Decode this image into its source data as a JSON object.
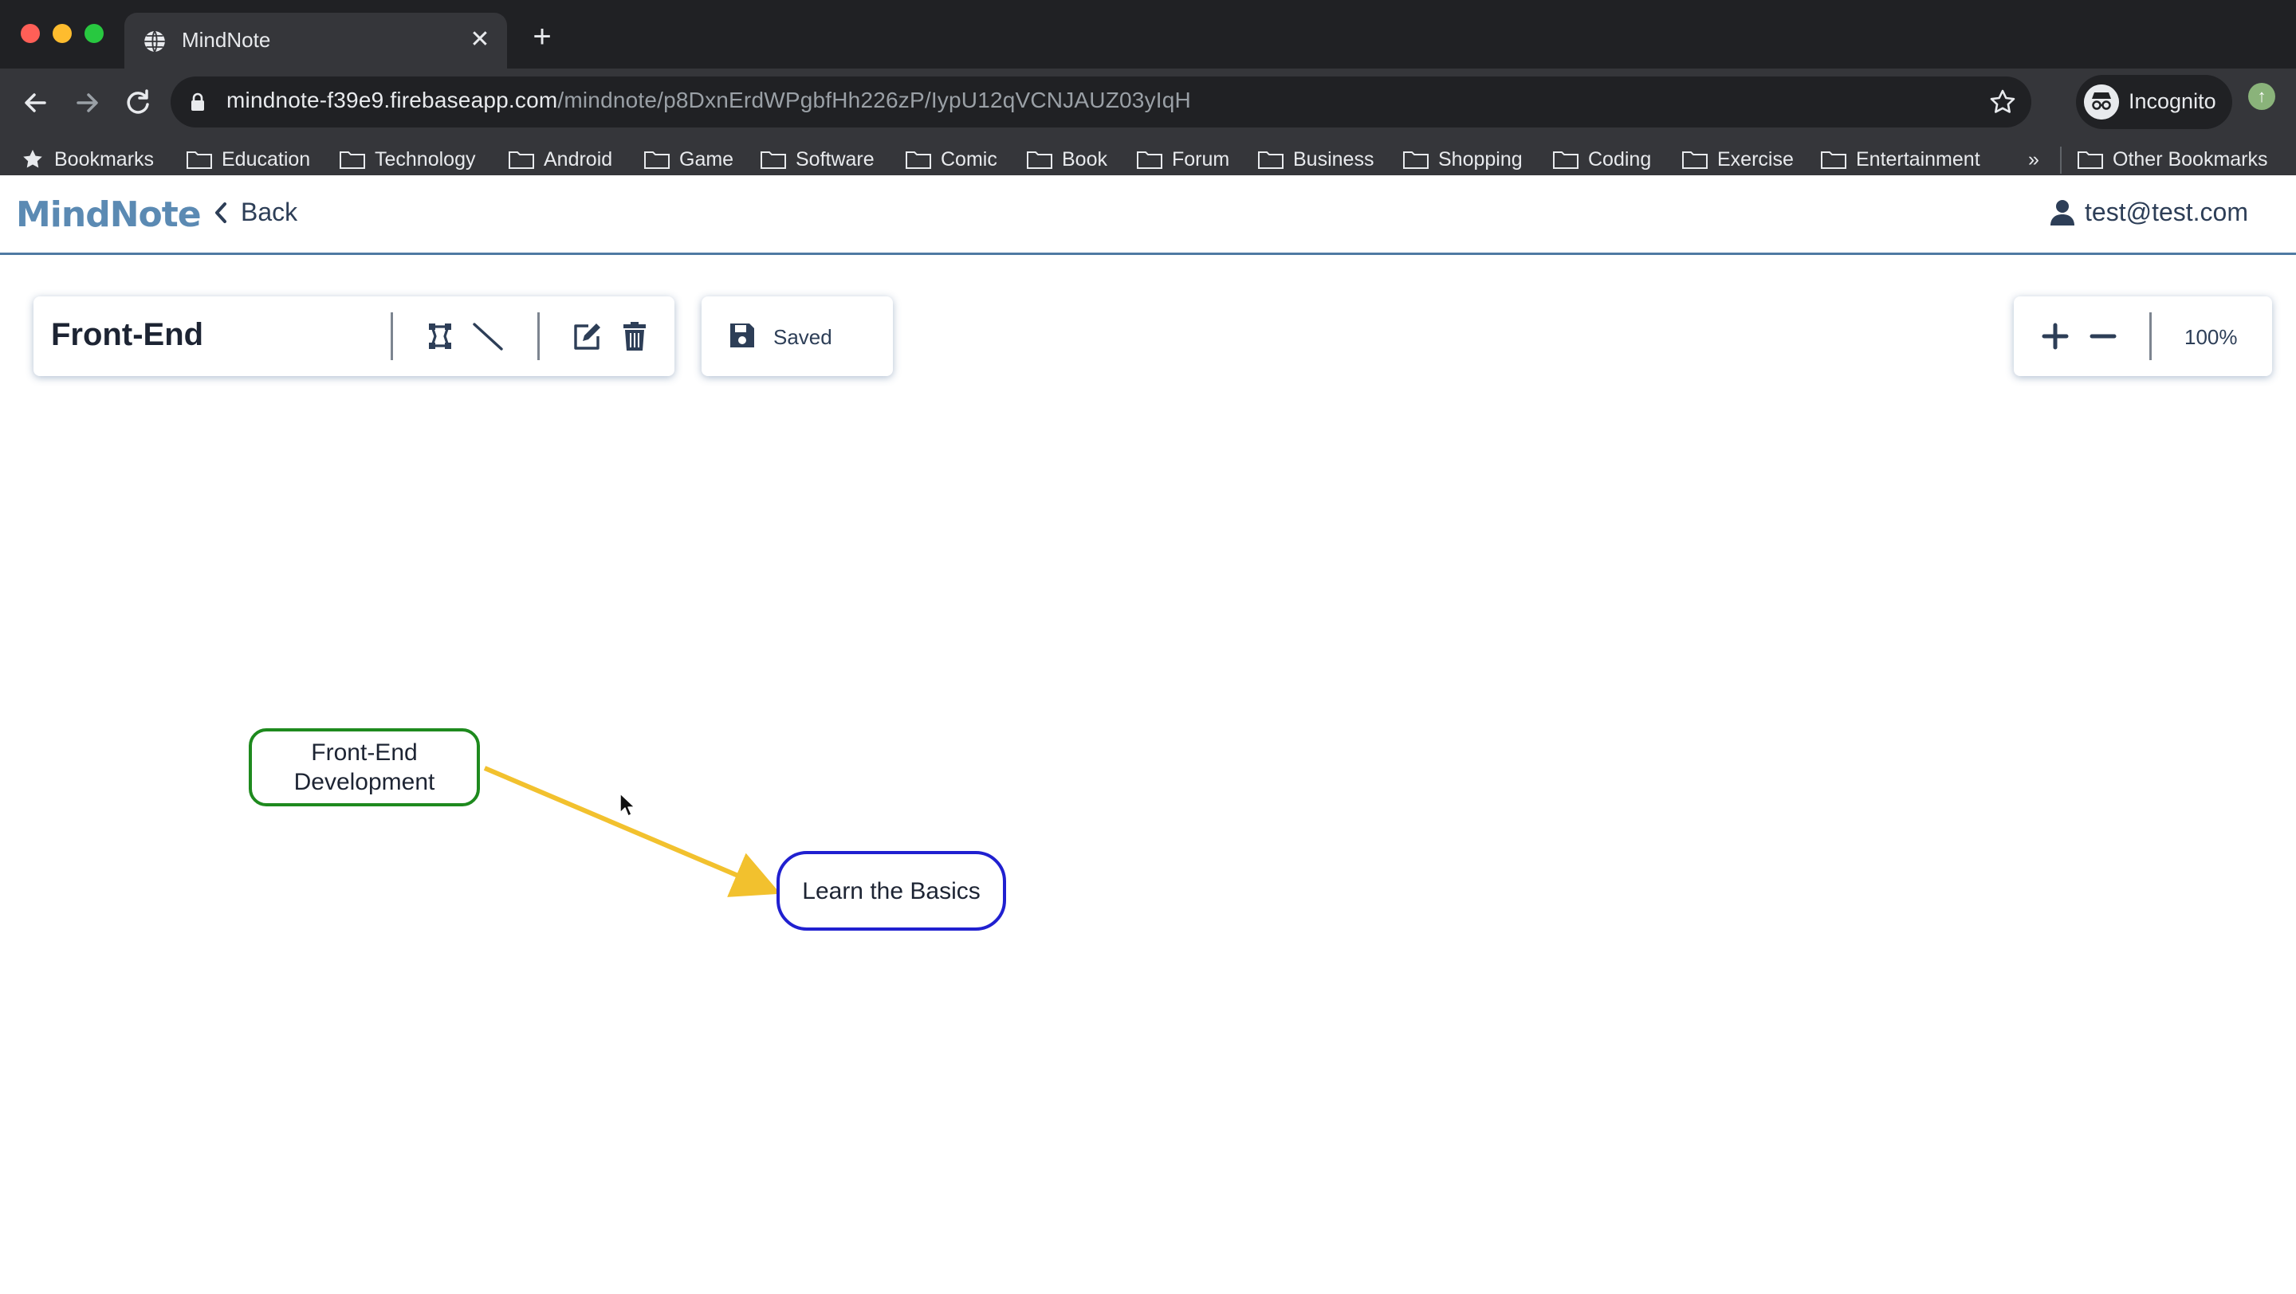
{
  "browser": {
    "tab_title": "MindNote",
    "url_host": "mindnote-f39e9.firebaseapp.com",
    "url_path": "/mindnote/p8DxnErdWPgbfHh226zP/IypU12qVCNJAUZ03yIqH",
    "profile_label": "Incognito",
    "bookmarks": [
      "Bookmarks",
      "Education",
      "Technology",
      "Android",
      "Game",
      "Software",
      "Comic",
      "Book",
      "Forum",
      "Business",
      "Shopping",
      "Coding",
      "Exercise",
      "Entertainment"
    ],
    "bookmarks_overflow": "»",
    "other_bookmarks": "Other Bookmarks",
    "icons": [
      "globe-icon",
      "close-icon",
      "plus-icon",
      "back-arrow-icon",
      "forward-arrow-icon",
      "reload-icon",
      "lock-icon",
      "star-icon",
      "incognito-icon",
      "folder-icon"
    ]
  },
  "app": {
    "logo": "MindNote",
    "back_label": "Back",
    "user_email": "test@test.com"
  },
  "editor": {
    "map_title": "Front-End",
    "save_status": "Saved",
    "zoom_level": "100%",
    "tools": [
      "add-node-icon",
      "add-line-icon",
      "edit-icon",
      "delete-icon"
    ]
  },
  "mindmap": {
    "nodes": [
      {
        "id": "a",
        "line1": "Front-End",
        "line2": "Development",
        "border_color": "#1e8a1e"
      },
      {
        "id": "b",
        "label": "Learn the Basics",
        "border_color": "#2020d0"
      }
    ],
    "edges": [
      {
        "from": "a",
        "to": "b",
        "color": "#f2c12e"
      }
    ]
  },
  "colors": {
    "accent": "#5b8ab3",
    "header_rule": "#4f7aa3",
    "text": "#2d3e57"
  }
}
